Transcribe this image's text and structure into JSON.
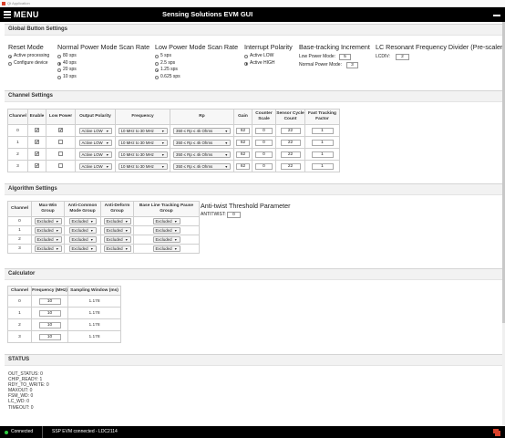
{
  "window": {
    "title": "Qt Application"
  },
  "header": {
    "menu_label": "MENU",
    "app_name": "Sensing Solutions EVM GUI"
  },
  "colors": {
    "header_bg": "#000000",
    "connected_dot": "#2ecc40",
    "ti_logo": "#d9412b"
  },
  "global": {
    "title": "Global Button Settings",
    "reset_mode": {
      "heading": "Reset Mode",
      "options": [
        "Active processing",
        "Configure device"
      ],
      "selected": 0
    },
    "normal_scan": {
      "heading": "Normal Power Mode Scan Rate",
      "options": [
        "80 sps",
        "40 sps",
        "20 sps",
        "10 sps"
      ],
      "selected": 1
    },
    "low_scan": {
      "heading": "Low Power Mode Scan Rate",
      "options": [
        "5 sps",
        "2.5 sps",
        "1.25 sps",
        "0.625 sps"
      ],
      "selected": 2
    },
    "interrupt": {
      "heading": "Interrupt Polarity",
      "options": [
        "Active LOW",
        "Active HIGH"
      ],
      "selected": 1
    },
    "baseline": {
      "heading": "Base-tracking Increment",
      "low_label": "Low Power Mode:",
      "low_value": "5",
      "normal_label": "Normal Power Mode:",
      "normal_value": "3"
    },
    "lc_divider": {
      "heading": "LC Resonant Frequency Divider (Pre-scaler)",
      "label": "LCDIV:",
      "value": "2"
    }
  },
  "channel_settings": {
    "title": "Channel Settings",
    "headers": [
      "Channel",
      "Enable",
      "Low Power",
      "Output Polarity",
      "Frequency",
      "Rp",
      "Gain",
      "Counter Scale",
      "Sensor Cycle Count",
      "Fast Tracking Factor"
    ],
    "rows": [
      {
        "channel": "0",
        "enable": true,
        "low_power": true,
        "polarity": "Active LOW",
        "frequency": "10 MHz to 30 MHz",
        "rp": "350 ≤ Rp ≤ 4k Ohms",
        "gain": "62",
        "counter_scale": "0",
        "cycle_count": "22",
        "fast_tracking": "1"
      },
      {
        "channel": "1",
        "enable": true,
        "low_power": false,
        "polarity": "Active LOW",
        "frequency": "10 MHz to 30 MHz",
        "rp": "350 ≤ Rp ≤ 4k Ohms",
        "gain": "62",
        "counter_scale": "0",
        "cycle_count": "22",
        "fast_tracking": "1"
      },
      {
        "channel": "2",
        "enable": true,
        "low_power": false,
        "polarity": "Active LOW",
        "frequency": "10 MHz to 30 MHz",
        "rp": "350 ≤ Rp ≤ 4k Ohms",
        "gain": "62",
        "counter_scale": "0",
        "cycle_count": "22",
        "fast_tracking": "1"
      },
      {
        "channel": "3",
        "enable": true,
        "low_power": false,
        "polarity": "Active LOW",
        "frequency": "10 MHz to 30 MHz",
        "rp": "350 ≤ Rp ≤ 4k Ohms",
        "gain": "62",
        "counter_scale": "0",
        "cycle_count": "22",
        "fast_tracking": "1"
      }
    ]
  },
  "algorithm": {
    "title": "Algorithm Settings",
    "headers": [
      "Channel",
      "Max-Win Group",
      "Anti-Common Mode Group",
      "Anti-Deform Group",
      "Base Line Tracking Pause Group"
    ],
    "rows": [
      {
        "channel": "0",
        "maxwin": "Excluded",
        "anticommon": "Excluded",
        "antideform": "Excluded",
        "baseline": "Excluded"
      },
      {
        "channel": "1",
        "maxwin": "Excluded",
        "anticommon": "Excluded",
        "antideform": "Excluded",
        "baseline": "Excluded"
      },
      {
        "channel": "2",
        "maxwin": "Excluded",
        "anticommon": "Excluded",
        "antideform": "Excluded",
        "baseline": "Excluded"
      },
      {
        "channel": "3",
        "maxwin": "Excluded",
        "anticommon": "Excluded",
        "antideform": "Excluded",
        "baseline": "Excluded"
      }
    ],
    "antitwist": {
      "heading": "Anti-twist Threshold Parameter",
      "label": "ANTITWIST:",
      "value": "0"
    }
  },
  "calculator": {
    "title": "Calculator",
    "headers": [
      "Channel",
      "Frequency (MHz)",
      "Sampling Window (ms)"
    ],
    "rows": [
      {
        "channel": "0",
        "frequency": "10",
        "window": "1.178"
      },
      {
        "channel": "1",
        "frequency": "10",
        "window": "1.178"
      },
      {
        "channel": "2",
        "frequency": "10",
        "window": "1.178"
      },
      {
        "channel": "3",
        "frequency": "10",
        "window": "1.178"
      }
    ]
  },
  "status": {
    "title": "STATUS",
    "lines": [
      "OUT_STATUS:  0",
      "CHIP_READY:  1",
      "RDY_TO_WRITE:  0",
      "MAXOUT:  0",
      "FSM_WD:  0",
      "LC_WD:  0",
      "TIMEOUT:  0"
    ]
  },
  "footer": {
    "connection": "Connected",
    "device": "SSP EVM connected - LDC2114"
  }
}
